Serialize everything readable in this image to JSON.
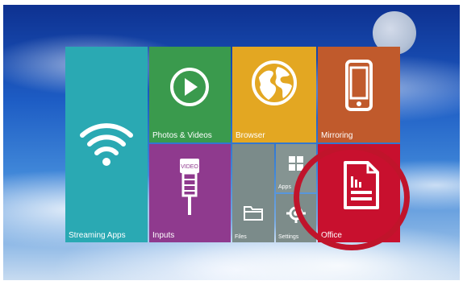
{
  "tiles": {
    "streaming": {
      "label": "Streaming Apps",
      "icon": "wifi-icon",
      "color": "#2aa9b3"
    },
    "photos": {
      "label": "Photos & Videos",
      "icon": "play-icon",
      "color": "#3a9a4d"
    },
    "browser": {
      "label": "Browser",
      "icon": "globe-icon",
      "color": "#e3a722"
    },
    "mirroring": {
      "label": "Mirroring",
      "icon": "phone-icon",
      "color": "#c05a2c"
    },
    "inputs": {
      "label": "Inputs",
      "icon": "video-cable-icon",
      "color": "#8f3a8e"
    },
    "files": {
      "label": "Files",
      "icon": "folder-icon",
      "color": "#7b8b8a"
    },
    "apps": {
      "label": "Apps",
      "icon": "windows-grid-icon",
      "color": "#859492"
    },
    "settings": {
      "label": "Settings",
      "icon": "gear-icon",
      "color": "#7d8c8a"
    },
    "office": {
      "label": "Office",
      "icon": "document-icon",
      "color": "#c8102e"
    }
  },
  "annotation": {
    "highlight": "office",
    "highlight_color": "#c0142b"
  },
  "inputs_icon_text": "VIDEO"
}
